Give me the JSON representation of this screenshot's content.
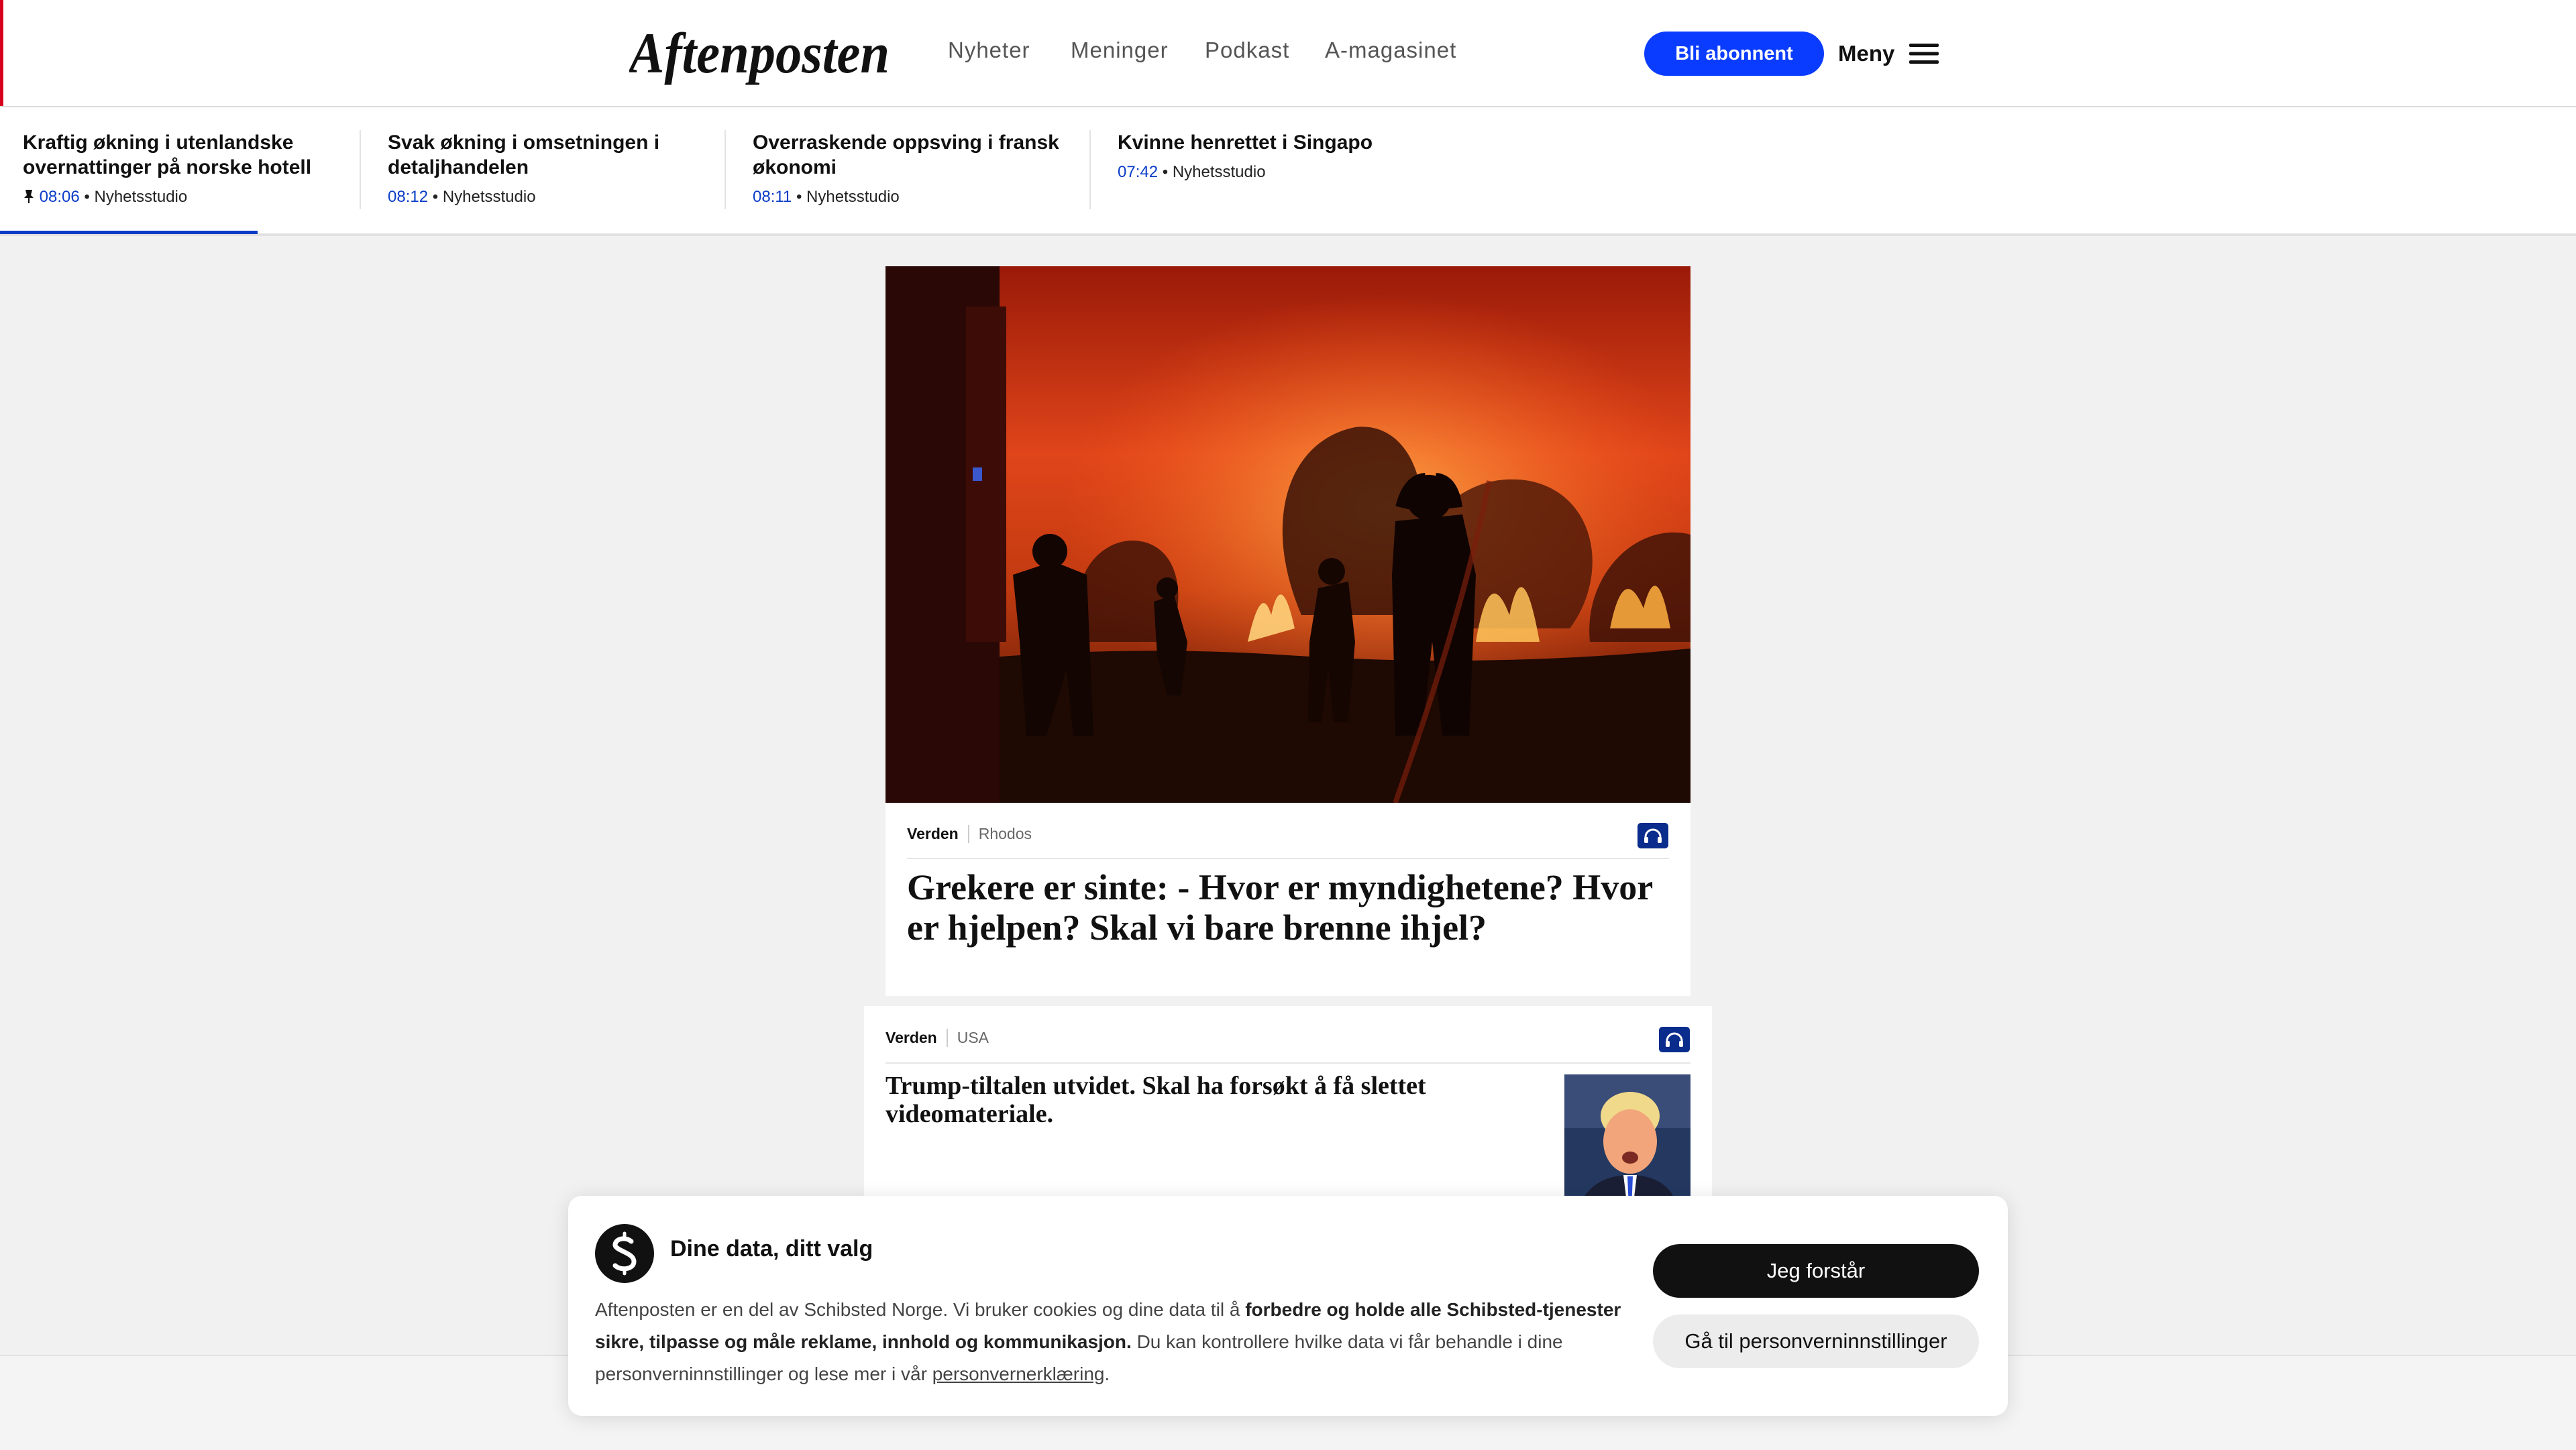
{
  "header": {
    "logo_text": "Aftenposten",
    "nav": [
      "Nyheter",
      "Meninger",
      "Podkast",
      "A-magasinet"
    ],
    "subscribe_label": "Bli abonnent",
    "menu_label": "Meny",
    "accent_color": "#0a3cff",
    "brand_red": "#d6001c"
  },
  "ticker": {
    "items": [
      {
        "title": "Kraftig økning i utenlandske overnattinger på norske hotell",
        "time": "08:06",
        "source": "Nyhetsstudio",
        "pinned": true
      },
      {
        "title": "Svak økning i omsetningen i detaljhandelen",
        "time": "08:12",
        "source": "Nyhetsstudio"
      },
      {
        "title": "Overraskende oppsving i fransk økonomi",
        "time": "08:11",
        "source": "Nyhetsstudio"
      },
      {
        "title": "Kvinne henrettet i Singapo",
        "time": "07:42",
        "source": "Nyhetsstudio"
      }
    ],
    "bullet": "•"
  },
  "main_article": {
    "section": "Verden",
    "subtag": "Rhodos",
    "headline": "Grekere er sinte: - Hvor er myndighetene? Hvor er hjelpen? Skal vi bare brenne ihjel?",
    "audio_icon": "headphones-icon"
  },
  "second_article": {
    "section": "Verden",
    "subtag": "USA",
    "headline": "Trump-tiltalen utvidet. Skal ha forsøkt å få slettet videomateriale.",
    "audio_icon": "headphones-icon"
  },
  "consent": {
    "title": "Dine data, ditt valg",
    "body_1": "Aftenposten er en del av Schibsted Norge. Vi bruker cookies og dine data til å ",
    "body_bold": "forbedre og holde alle Schibsted-tjenester sikre, tilpasse og måle reklame, innhold og kommunikasjon.",
    "body_2": " Du kan kontrollere hvilke data vi får behandle i dine personverninnstillinger og lese mer i vår ",
    "link_label": "personvernerklæring",
    "body_end": ".",
    "accept_label": "Jeg forstår",
    "settings_label": "Gå til personverninnstillinger"
  }
}
